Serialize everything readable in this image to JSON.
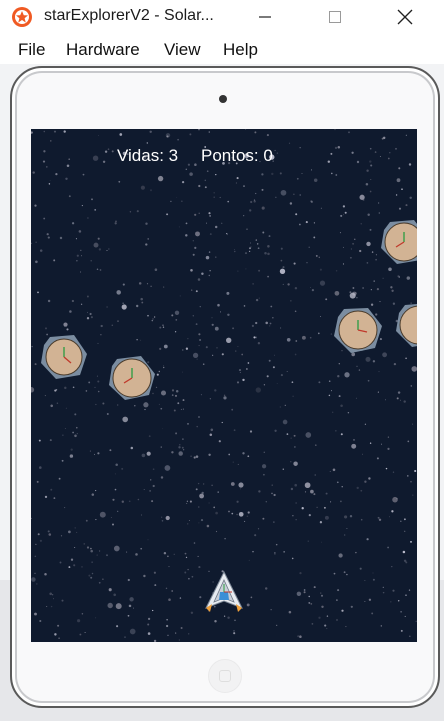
{
  "window": {
    "title": "starExplorerV2 - Solar...",
    "icon": "app-icon",
    "controls": [
      "minimize-icon",
      "maximize-icon",
      "close-icon"
    ]
  },
  "menu": {
    "items": [
      "File",
      "Hardware",
      "View",
      "Help"
    ]
  },
  "game": {
    "lives_label": "Vidas:",
    "lives_value": 3,
    "score_label": "Pontos:",
    "score_value": 0,
    "lives_text": "Vidas: 3",
    "score_text": "Pontos: 0"
  },
  "colors": {
    "space_bg": "#0f1a2e",
    "asteroid_fill": "#d2b394",
    "asteroid_hex": "#8ea2b5",
    "ship_body": "#c9cfd8",
    "ship_accent": "#3a8fd6",
    "app_icon": "#f05a23"
  }
}
